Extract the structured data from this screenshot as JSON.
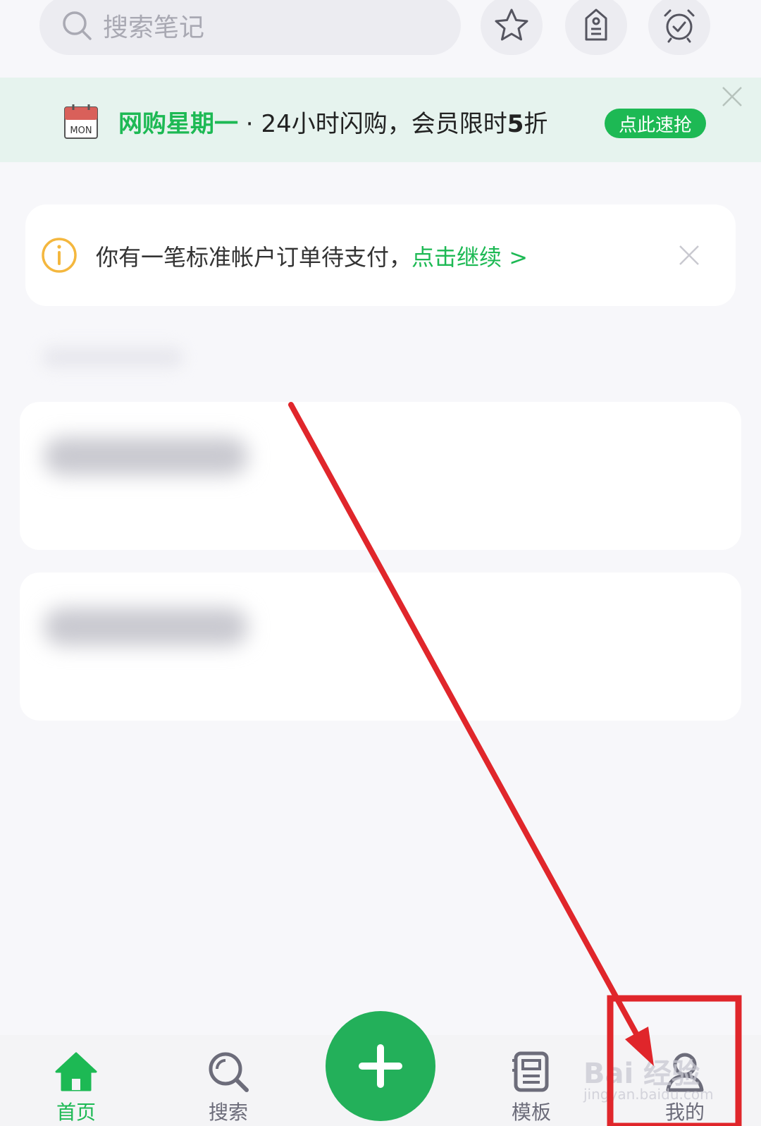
{
  "search": {
    "placeholder": "搜索笔记"
  },
  "header_icons": [
    "star-icon",
    "tag-icon",
    "alarm-clock-icon"
  ],
  "promo": {
    "calendar_label": "MON",
    "highlight": "网购星期一",
    "separator": " · ",
    "text_part1": "24小时闪购，会员限时",
    "text_bold": "5",
    "text_part2": "折",
    "cta": "点此速抢"
  },
  "alert": {
    "message": "你有一笔标准帐户订单待支付，",
    "link": "点击继续 >"
  },
  "tabs": [
    {
      "label": "首页",
      "icon": "home-icon",
      "active": true
    },
    {
      "label": "搜索",
      "icon": "search-icon",
      "active": false
    },
    {
      "label": "模板",
      "icon": "template-icon",
      "active": false
    },
    {
      "label": "我的",
      "icon": "user-icon",
      "active": false
    }
  ],
  "watermark": {
    "brand": "Bai 经验",
    "url": "jingyan.baidu.com"
  },
  "colors": {
    "accent": "#1db954",
    "annotation": "#e0262b",
    "warning": "#f4b73e"
  }
}
